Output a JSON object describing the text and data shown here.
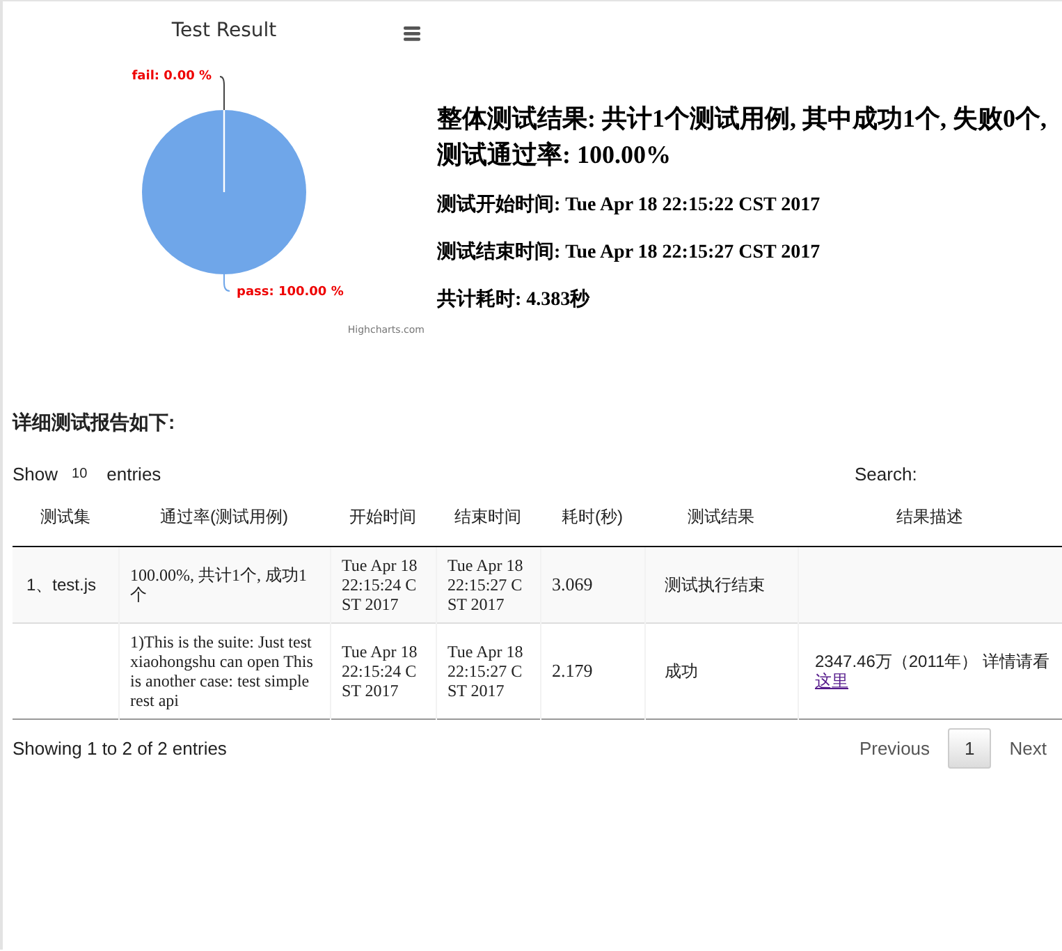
{
  "chart": {
    "credit": "Highcharts.com",
    "chart_data": {
      "type": "pie",
      "title": "Test Result",
      "series": [
        {
          "color": "#6fa6e9",
          "values": [
            0,
            100
          ]
        }
      ],
      "value_labels": [
        "fail: 0.00 %",
        "pass: 100.00 %"
      ]
    }
  },
  "summary": {
    "heading": "整体测试结果: 共计1个测试用例, 其中成功1个, 失败0个, 测试通过率: 100.00%",
    "lines": [
      "测试开始时间: Tue Apr 18 22:15:22 CST 2017",
      "测试结束时间: Tue Apr 18 22:15:27 CST 2017",
      "共计耗时: 4.383秒"
    ]
  },
  "report": {
    "title": "详细测试报告如下:",
    "show_label": "Show",
    "page_size": "10",
    "entries_label": "entries",
    "search_label": "Search:",
    "columns": [
      "测试集",
      "通过率(测试用例)",
      "开始时间",
      "结束时间",
      "耗时(秒)",
      "测试结果",
      "结果描述"
    ],
    "rows": [
      {
        "suite": "1、test.js",
        "pass_rate": "100.00%, 共计1个, 成功1个",
        "start": "Tue Apr 18 22:15:24 CST 2017",
        "end": "Tue Apr 18 22:15:27 CST 2017",
        "duration": "3.069",
        "result": "测试执行结束"
      },
      {
        "pass_rate": "1)This is the suite: Just test xiaohongshu can open This is another case: test simple rest api",
        "start": "Tue Apr 18 22:15:24 CST 2017",
        "end": "Tue Apr 18 22:15:27 CST 2017",
        "duration": "2.179",
        "result": "成功",
        "description": "2347.46万（2011年） 详情请看",
        "link": "这里"
      }
    ],
    "info": "Showing 1 to 2 of 2 entries",
    "previous": "Previous",
    "pages": [
      {
        "label": "1",
        "selected": true
      }
    ],
    "next": "Next"
  }
}
